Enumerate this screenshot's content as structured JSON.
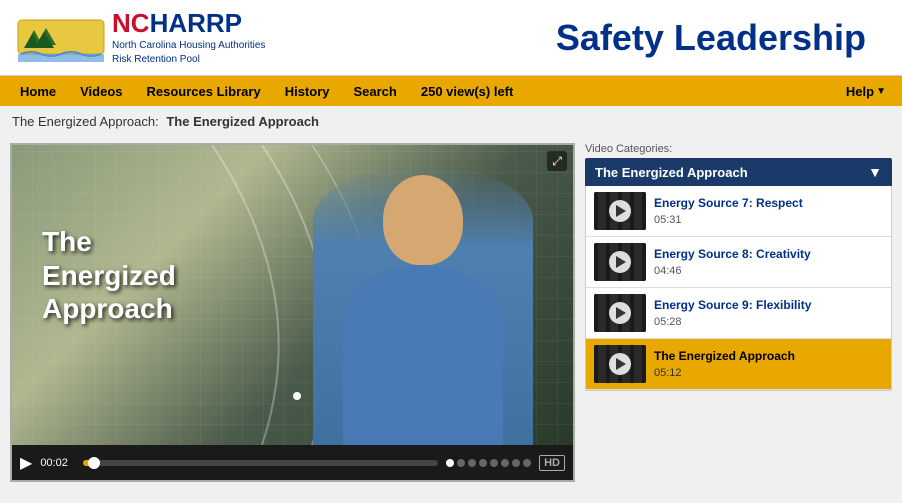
{
  "header": {
    "logo_nc": "NC",
    "logo_harrp": "HARRP",
    "logo_line1": "North Carolina Housing Authorities",
    "logo_line2": "Risk Retention Pool",
    "page_title": "Safety Leadership"
  },
  "navbar": {
    "items": [
      {
        "id": "home",
        "label": "Home"
      },
      {
        "id": "videos",
        "label": "Videos"
      },
      {
        "id": "resources",
        "label": "Resources Library"
      },
      {
        "id": "history",
        "label": "History"
      },
      {
        "id": "search",
        "label": "Search"
      }
    ],
    "views_left": "250 view(s) left",
    "help_label": "Help"
  },
  "breadcrumb": {
    "prefix": "The Energized Approach:",
    "current": "The Energized Approach"
  },
  "video_player": {
    "title_line1": "The",
    "title_line2": "Energized",
    "title_line3": "Approach",
    "time_current": "00:02",
    "hd_label": "HD"
  },
  "sidebar": {
    "categories_label": "Video Categories:",
    "selected_category": "The Energized Approach",
    "videos": [
      {
        "id": "v7",
        "title": "Energy Source 7: Respect",
        "duration": "05:31",
        "active": false
      },
      {
        "id": "v8",
        "title": "Energy Source 8: Creativity",
        "duration": "04:46",
        "active": false
      },
      {
        "id": "v9",
        "title": "Energy Source 9: Flexibility",
        "duration": "05:28",
        "active": false
      },
      {
        "id": "v10",
        "title": "The Energized Approach",
        "duration": "05:12",
        "active": true
      }
    ]
  }
}
